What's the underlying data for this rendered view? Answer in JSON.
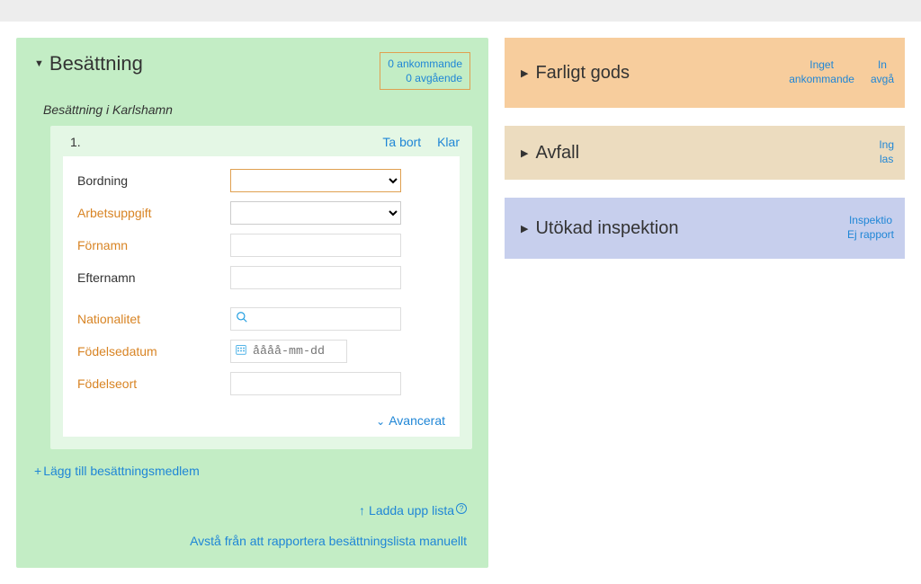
{
  "left": {
    "title": "Besättning",
    "badge_line1": "0 ankommande",
    "badge_line2": "0 avgående",
    "subheading": "Besättning i Karlshamn",
    "entry_num": "1.",
    "actions": {
      "remove": "Ta bort",
      "done": "Klar"
    },
    "labels": {
      "bordning": "Bordning",
      "arbetsuppgift": "Arbetsuppgift",
      "fornamn": "Förnamn",
      "efternamn": "Efternamn",
      "nationalitet": "Nationalitet",
      "fodelsedatum": "Födelsedatum",
      "fodelseort": "Födelseort"
    },
    "placeholders": {
      "date": "åååå-mm-dd"
    },
    "advanced": "Avancerat",
    "add_member": "Lägg till besättningsmedlem",
    "upload_list": "Ladda upp lista",
    "abstain": "Avstå från att rapportera besättningslista manuellt"
  },
  "right": {
    "panels": [
      {
        "id": "farligt",
        "title": "Farligt gods",
        "status": [
          "Inget\nankommande",
          "In\navgå"
        ]
      },
      {
        "id": "avfall",
        "title": "Avfall",
        "status": [
          "Ing\nlas"
        ]
      },
      {
        "id": "inspektion",
        "title": "Utökad inspektion",
        "status": [
          "Inspektio\nEj rapport"
        ]
      }
    ]
  }
}
